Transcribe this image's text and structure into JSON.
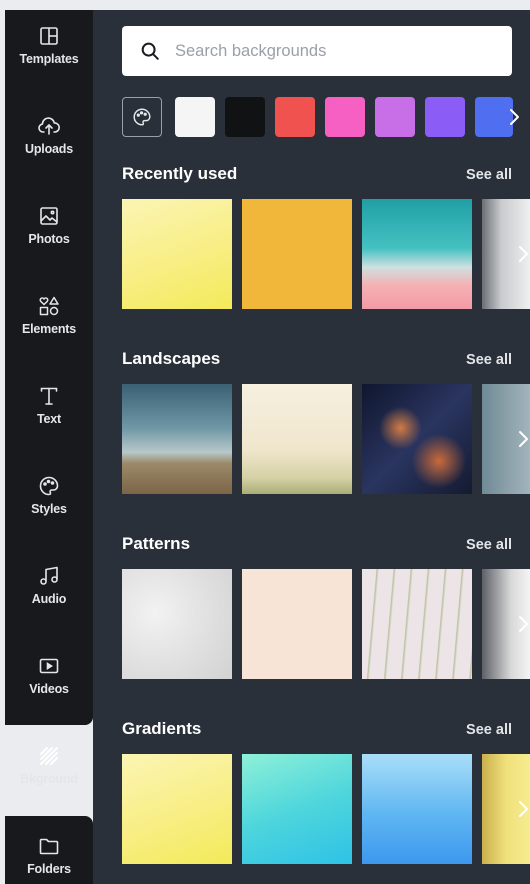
{
  "sidebar": {
    "items": [
      {
        "label": "Templates",
        "icon": "templates-icon"
      },
      {
        "label": "Uploads",
        "icon": "upload-cloud-icon"
      },
      {
        "label": "Photos",
        "icon": "photo-icon"
      },
      {
        "label": "Elements",
        "icon": "shapes-icon"
      },
      {
        "label": "Text",
        "icon": "text-t-icon"
      },
      {
        "label": "Styles",
        "icon": "palette-icon"
      },
      {
        "label": "Audio",
        "icon": "music-note-icon"
      },
      {
        "label": "Videos",
        "icon": "video-play-icon"
      },
      {
        "label": "Bkground",
        "icon": "background-stripes-icon"
      },
      {
        "label": "Folders",
        "icon": "folder-icon"
      }
    ],
    "active": "Bkground"
  },
  "search": {
    "placeholder": "Search backgrounds"
  },
  "swatches": [
    "#f5f5f5",
    "#111214",
    "#f0534f",
    "#f660c2",
    "#c86ee6",
    "#8b5cf6",
    "#4f6ff0"
  ],
  "sections": [
    {
      "title": "Recently used",
      "see_all": "See all"
    },
    {
      "title": "Landscapes",
      "see_all": "See all"
    },
    {
      "title": "Patterns",
      "see_all": "See all"
    },
    {
      "title": "Gradients",
      "see_all": "See all"
    }
  ]
}
